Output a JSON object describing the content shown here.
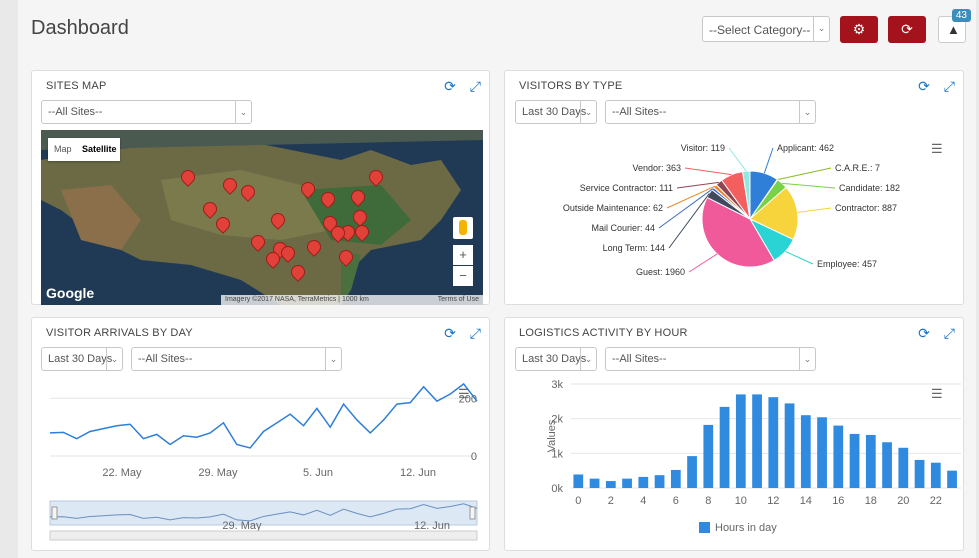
{
  "header": {
    "title": "Dashboard",
    "category_select": "--Select Category--",
    "notification_count": "43"
  },
  "sites_map": {
    "title": "SITES MAP",
    "site_select": "--All Sites--",
    "map_tab": "Map",
    "satellite_tab": "Satellite",
    "google_label": "Google",
    "attribution": "Imagery ©2017 NASA, TerraMetrics | 1000 km",
    "terms": "Terms of Use",
    "zoom_in": "+",
    "zoom_out": "−"
  },
  "visitors_by_type": {
    "title": "VISITORS BY TYPE",
    "range_select": "Last 30 Days",
    "site_select": "--All Sites--"
  },
  "visitor_arrivals": {
    "title": "VISITOR ARRIVALS BY DAY",
    "range_select": "Last 30 Days",
    "site_select": "--All Sites--"
  },
  "logistics": {
    "title": "LOGISTICS ACTIVITY BY HOUR",
    "range_select": "Last 30 Days",
    "site_select": "--All Sites--"
  },
  "chart_data": [
    {
      "type": "pie",
      "title": "",
      "slices": [
        {
          "label": "Applicant: 462",
          "value": 462,
          "color": "#2f7ed8"
        },
        {
          "label": "C.A.R.E.: 7",
          "value": 7,
          "color": "#8bbc21"
        },
        {
          "label": "Candidate: 182",
          "value": 182,
          "color": "#77d344"
        },
        {
          "label": "Contractor: 887",
          "value": 887,
          "color": "#f7d33c"
        },
        {
          "label": "Employee: 457",
          "value": 457,
          "color": "#2ad4d4"
        },
        {
          "label": "Guest: 1960",
          "value": 1960,
          "color": "#f05a9b"
        },
        {
          "label": "Long Term: 144",
          "value": 144,
          "color": "#404a5c"
        },
        {
          "label": "Mail Courier: 44",
          "value": 44,
          "color": "#3d6ec9"
        },
        {
          "label": "Outside Maintenance: 62",
          "value": 62,
          "color": "#e8882d"
        },
        {
          "label": "Service Contractor: 111",
          "value": 111,
          "color": "#8d4653"
        },
        {
          "label": "Vendor: 363",
          "value": 363,
          "color": "#f35e5e"
        },
        {
          "label": "Visitor: 119",
          "value": 119,
          "color": "#91e8e1"
        }
      ]
    },
    {
      "type": "line",
      "title": "",
      "x_ticks": [
        "22. May",
        "29. May",
        "5. Jun",
        "12. Jun"
      ],
      "y_ticks": [
        0,
        200
      ],
      "ylim": [
        0,
        260
      ],
      "values": [
        80,
        82,
        60,
        85,
        95,
        105,
        110,
        60,
        75,
        40,
        70,
        65,
        80,
        115,
        40,
        28,
        85,
        115,
        145,
        105,
        165,
        100,
        180,
        125,
        80,
        125,
        180,
        185,
        240,
        190,
        215,
        250,
        190
      ],
      "navigator_ticks": [
        "29. May",
        "12. Jun"
      ]
    },
    {
      "type": "bar",
      "title": "",
      "categories": [
        "0",
        "1",
        "2",
        "3",
        "4",
        "5",
        "6",
        "7",
        "8",
        "9",
        "10",
        "11",
        "12",
        "13",
        "14",
        "15",
        "16",
        "17",
        "18",
        "19",
        "20",
        "21",
        "22",
        "23"
      ],
      "x_ticks": [
        "0",
        "2",
        "4",
        "6",
        "8",
        "10",
        "12",
        "14",
        "16",
        "18",
        "20",
        "22"
      ],
      "values": [
        390,
        270,
        200,
        270,
        320,
        370,
        520,
        920,
        1820,
        2340,
        2700,
        2700,
        2620,
        2440,
        2100,
        2040,
        1800,
        1560,
        1530,
        1320,
        1160,
        810,
        730,
        500
      ],
      "y_ticks": [
        "0k",
        "1k",
        "2k",
        "3k"
      ],
      "ylim": [
        0,
        3000
      ],
      "ylabel": "Values",
      "legend": "Hours in day",
      "color": "#2f8ae0"
    }
  ]
}
